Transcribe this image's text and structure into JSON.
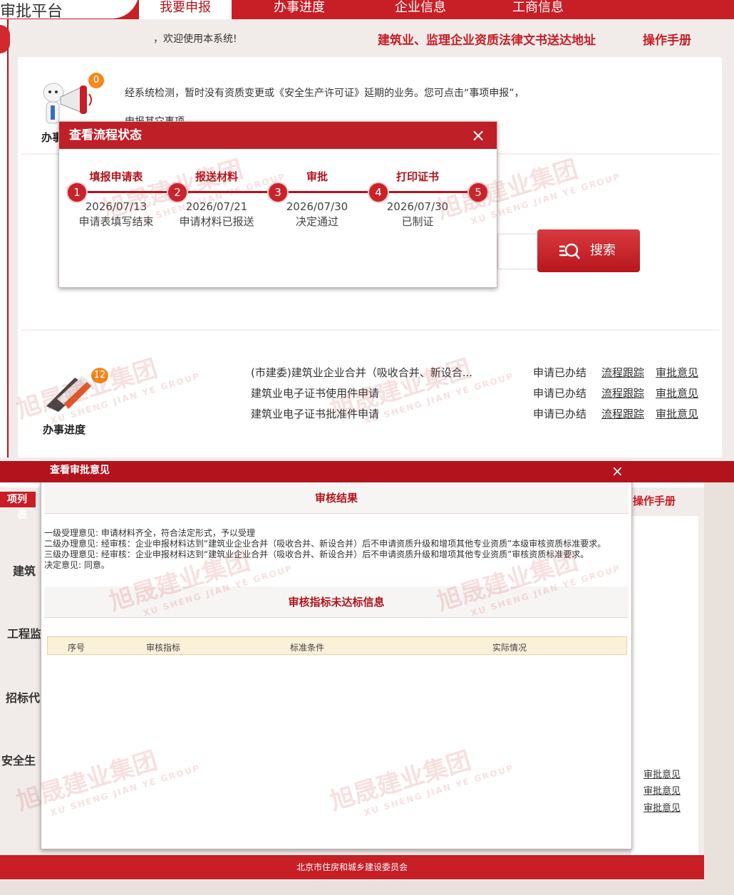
{
  "top": {
    "brand": "审批平台",
    "nav": [
      "我要申报",
      "办事进度",
      "企业信息",
      "工商信息"
    ],
    "welcome": "，欢迎使用本系统!",
    "law_link": "建筑业、监理企业资质法律文书送达地址",
    "manual": "操作手册",
    "notice_badge": "0",
    "notice": "经系统检测，暂时没有资质变更或《安全生产许可证》延期的业务。您可点击“事项申报”，",
    "notice2": "申报其它事项。",
    "menu1_label": "办事",
    "search_btn": "搜索",
    "progress_badge": "12",
    "progress_label": "办事进度",
    "progress_rows": [
      {
        "title": "(市建委)建筑业企业合并（吸收合并、新设合...",
        "status": "申请已办结",
        "link1": "流程跟踪",
        "link2": "审批意见"
      },
      {
        "title": "建筑业电子证书使用件申请",
        "status": "申请已办结",
        "link1": "流程跟踪",
        "link2": "审批意见"
      },
      {
        "title": "建筑业电子证书批准件申请",
        "status": "申请已办结",
        "link1": "流程跟踪",
        "link2": "审批意见"
      }
    ]
  },
  "flow_dialog": {
    "title": "查看流程状态",
    "close": "×",
    "steps": [
      {
        "name": "填报申请表",
        "num": "1",
        "date": "2026/07/13",
        "status": "申请表填写结束"
      },
      {
        "name": "报送材料",
        "num": "2",
        "date": "2026/07/21",
        "status": "申请材料已报送"
      },
      {
        "name": "审批",
        "num": "3",
        "date": "2026/07/30",
        "status": "决定通过"
      },
      {
        "name": "打印证书",
        "num": "4",
        "date": "2026/07/30",
        "status": "已制证"
      },
      {
        "name": "",
        "num": "5",
        "date": "",
        "status": ""
      }
    ]
  },
  "bottom": {
    "list_label": "项列表",
    "manual": "操作手册",
    "left_menu": [
      "建筑",
      "工程监",
      "招标代",
      "安全生"
    ],
    "right_links": [
      "审批意见",
      "审批意见",
      "审批意见"
    ],
    "footer": "北京市住房和城乡建设委员会"
  },
  "approval_dialog": {
    "title": "查看审批意见",
    "close": "×",
    "result_heading": "审核结果",
    "opinions": [
      "一级受理意见: 申请材料齐全，符合法定形式，予以受理",
      "二级办理意见: 经审核：企业申报材料达到“建筑业企业合并（吸收合并、新设合并）后不申请资质升级和增项其他专业资质”本级审核资质标准要求。",
      "三级办理意见: 经审核：企业申报材料达到“建筑业企业合并（吸收合并、新设合并）后不申请资质升级和增项其他专业资质”审核资质标准要求。",
      "决定意见: 同意。"
    ],
    "fail_heading": "审核指标未达标信息",
    "table_headers": [
      "序号",
      "审核指标",
      "标准条件",
      "实际情况"
    ]
  },
  "watermark": {
    "cn": "旭晟建业集团",
    "en": "XU SHENG JIAN YE GROUP"
  },
  "colors": {
    "brand_red": "#c81e26",
    "badge_orange": "#f28a1e"
  }
}
